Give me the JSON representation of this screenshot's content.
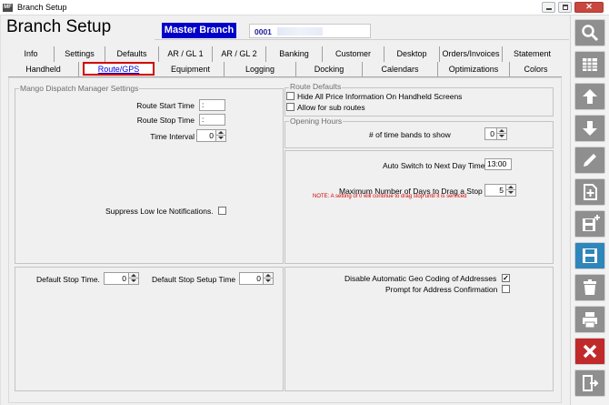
{
  "window": {
    "title": "Branch Setup",
    "app_icon_text": "MF"
  },
  "header": {
    "title": "Branch Setup",
    "master_label": "Master Branch",
    "branch_code": "0001"
  },
  "tabs_row1": [
    "Info",
    "Settings",
    "Defaults",
    "AR / GL 1",
    "AR / GL 2",
    "Banking",
    "Customer",
    "Desktop",
    "Orders/Invoices",
    "Statement"
  ],
  "tabs_row2": [
    "Handheld",
    "Route/GPS",
    "Equipment",
    "Logging",
    "Docking",
    "Calendars",
    "Optimizations",
    "Colors"
  ],
  "active_tab": "Route/GPS",
  "mango": {
    "legend": "Mango Dispatch Manager Settings",
    "route_start_label": "Route Start Time",
    "route_start_value": ":",
    "route_stop_label": "Route Stop Time",
    "route_stop_value": ":",
    "time_interval_label": "Time Interval",
    "time_interval_value": "0",
    "suppress_label": "Suppress Low Ice Notifications.",
    "suppress_checked": false
  },
  "stops": {
    "default_stop_label": "Default Stop Time.",
    "default_stop_value": "0",
    "setup_label": "Default Stop Setup Time",
    "setup_value": "0"
  },
  "route_defaults": {
    "legend": "Route Defaults",
    "hide_price_label": "Hide All Price Information On Handheld Screens",
    "hide_price_checked": false,
    "sub_routes_label": "Allow for sub routes",
    "sub_routes_checked": false
  },
  "opening_hours": {
    "legend": "Opening Hours",
    "bands_label": "# of time bands to show",
    "bands_value": "0"
  },
  "auto_switch": {
    "label": "Auto Switch to Next Day Time",
    "value": "13:00",
    "max_days_label": "Maximum Number of Days to Drag a Stop",
    "max_days_value": "5",
    "note": "NOTE: A setting of 0 will continue to drag stop until it is serviced"
  },
  "geo": {
    "disable_label": "Disable Automatic Geo Coding of Addresses",
    "disable_checked": true,
    "prompt_label": "Prompt for Address Confirmation",
    "prompt_checked": false
  },
  "toolbar_icons": [
    "search-icon",
    "grid-icon",
    "arrow-up-icon",
    "arrow-down-icon",
    "pencil-icon",
    "new-document-icon",
    "save-new-icon",
    "save-icon",
    "delete-icon",
    "print-icon",
    "close-icon",
    "exit-icon"
  ],
  "colors": {
    "master_bg": "#0000c8",
    "active_tab_border": "#d00000",
    "note_text": "#d00000",
    "save_button": "#2f86bb",
    "close_button": "#c12a2a"
  }
}
